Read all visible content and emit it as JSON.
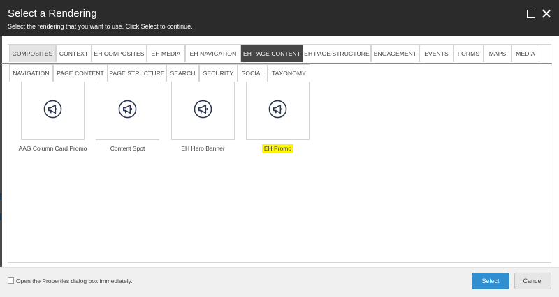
{
  "dialog": {
    "title": "Select a Rendering",
    "subtitle": "Select the rendering that you want to use. Click Select to continue."
  },
  "tabs_row1": [
    {
      "label": "COMPOSITES",
      "state": "selected-light"
    },
    {
      "label": "CONTEXT"
    },
    {
      "label": "EH COMPOSITES"
    },
    {
      "label": "EH MEDIA"
    },
    {
      "label": "EH NAVIGATION"
    },
    {
      "label": "EH PAGE CONTENT",
      "state": "selected-dark"
    },
    {
      "label": "EH PAGE STRUCTURE"
    },
    {
      "label": "ENGAGEMENT"
    },
    {
      "label": "EVENTS"
    },
    {
      "label": "FORMS"
    },
    {
      "label": "MAPS"
    },
    {
      "label": "MEDIA"
    }
  ],
  "tabs_row2": [
    {
      "label": "NAVIGATION"
    },
    {
      "label": "PAGE CONTENT"
    },
    {
      "label": "PAGE STRUCTURE"
    },
    {
      "label": "SEARCH"
    },
    {
      "label": "SECURITY"
    },
    {
      "label": "SOCIAL"
    },
    {
      "label": "TAXONOMY"
    }
  ],
  "renderings": [
    {
      "label": "AAG Column Card Promo",
      "icon": "megaphone-icon"
    },
    {
      "label": "Content Spot",
      "icon": "megaphone-icon"
    },
    {
      "label": "EH Hero Banner",
      "icon": "megaphone-icon"
    },
    {
      "label": "EH Promo",
      "icon": "megaphone-icon",
      "highlighted": true
    }
  ],
  "footer": {
    "checkbox_label": "Open the Properties dialog box immediately.",
    "checkbox_checked": false,
    "select_label": "Select",
    "cancel_label": "Cancel"
  },
  "colors": {
    "header_bg": "#2b2b2b",
    "active_tab_dark": "#474747",
    "select_button": "#2f8fd0",
    "highlight": "#fff700"
  }
}
